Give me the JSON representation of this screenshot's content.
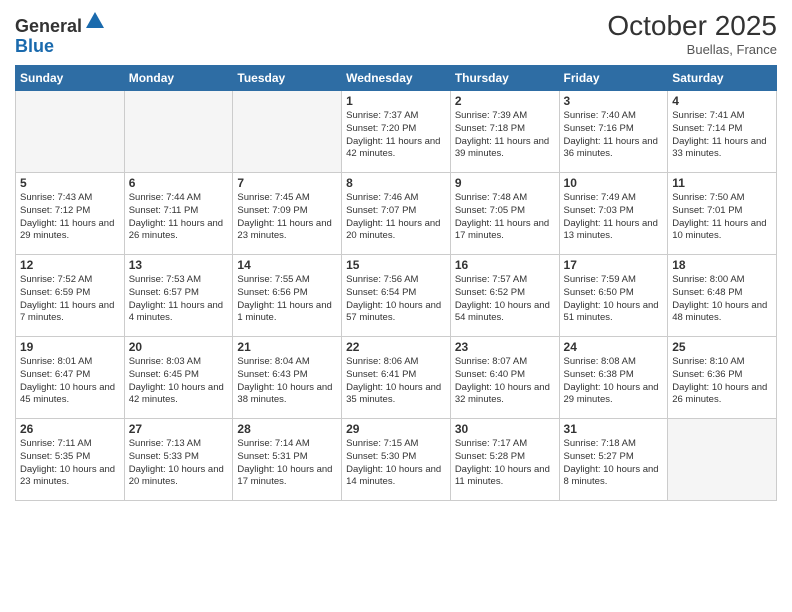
{
  "header": {
    "logo_general": "General",
    "logo_blue": "Blue",
    "month_title": "October 2025",
    "location": "Buellas, France"
  },
  "weekdays": [
    "Sunday",
    "Monday",
    "Tuesday",
    "Wednesday",
    "Thursday",
    "Friday",
    "Saturday"
  ],
  "weeks": [
    [
      {
        "day": "",
        "sunrise": "",
        "sunset": "",
        "daylight": ""
      },
      {
        "day": "",
        "sunrise": "",
        "sunset": "",
        "daylight": ""
      },
      {
        "day": "",
        "sunrise": "",
        "sunset": "",
        "daylight": ""
      },
      {
        "day": "1",
        "sunrise": "Sunrise: 7:37 AM",
        "sunset": "Sunset: 7:20 PM",
        "daylight": "Daylight: 11 hours and 42 minutes."
      },
      {
        "day": "2",
        "sunrise": "Sunrise: 7:39 AM",
        "sunset": "Sunset: 7:18 PM",
        "daylight": "Daylight: 11 hours and 39 minutes."
      },
      {
        "day": "3",
        "sunrise": "Sunrise: 7:40 AM",
        "sunset": "Sunset: 7:16 PM",
        "daylight": "Daylight: 11 hours and 36 minutes."
      },
      {
        "day": "4",
        "sunrise": "Sunrise: 7:41 AM",
        "sunset": "Sunset: 7:14 PM",
        "daylight": "Daylight: 11 hours and 33 minutes."
      }
    ],
    [
      {
        "day": "5",
        "sunrise": "Sunrise: 7:43 AM",
        "sunset": "Sunset: 7:12 PM",
        "daylight": "Daylight: 11 hours and 29 minutes."
      },
      {
        "day": "6",
        "sunrise": "Sunrise: 7:44 AM",
        "sunset": "Sunset: 7:11 PM",
        "daylight": "Daylight: 11 hours and 26 minutes."
      },
      {
        "day": "7",
        "sunrise": "Sunrise: 7:45 AM",
        "sunset": "Sunset: 7:09 PM",
        "daylight": "Daylight: 11 hours and 23 minutes."
      },
      {
        "day": "8",
        "sunrise": "Sunrise: 7:46 AM",
        "sunset": "Sunset: 7:07 PM",
        "daylight": "Daylight: 11 hours and 20 minutes."
      },
      {
        "day": "9",
        "sunrise": "Sunrise: 7:48 AM",
        "sunset": "Sunset: 7:05 PM",
        "daylight": "Daylight: 11 hours and 17 minutes."
      },
      {
        "day": "10",
        "sunrise": "Sunrise: 7:49 AM",
        "sunset": "Sunset: 7:03 PM",
        "daylight": "Daylight: 11 hours and 13 minutes."
      },
      {
        "day": "11",
        "sunrise": "Sunrise: 7:50 AM",
        "sunset": "Sunset: 7:01 PM",
        "daylight": "Daylight: 11 hours and 10 minutes."
      }
    ],
    [
      {
        "day": "12",
        "sunrise": "Sunrise: 7:52 AM",
        "sunset": "Sunset: 6:59 PM",
        "daylight": "Daylight: 11 hours and 7 minutes."
      },
      {
        "day": "13",
        "sunrise": "Sunrise: 7:53 AM",
        "sunset": "Sunset: 6:57 PM",
        "daylight": "Daylight: 11 hours and 4 minutes."
      },
      {
        "day": "14",
        "sunrise": "Sunrise: 7:55 AM",
        "sunset": "Sunset: 6:56 PM",
        "daylight": "Daylight: 11 hours and 1 minute."
      },
      {
        "day": "15",
        "sunrise": "Sunrise: 7:56 AM",
        "sunset": "Sunset: 6:54 PM",
        "daylight": "Daylight: 10 hours and 57 minutes."
      },
      {
        "day": "16",
        "sunrise": "Sunrise: 7:57 AM",
        "sunset": "Sunset: 6:52 PM",
        "daylight": "Daylight: 10 hours and 54 minutes."
      },
      {
        "day": "17",
        "sunrise": "Sunrise: 7:59 AM",
        "sunset": "Sunset: 6:50 PM",
        "daylight": "Daylight: 10 hours and 51 minutes."
      },
      {
        "day": "18",
        "sunrise": "Sunrise: 8:00 AM",
        "sunset": "Sunset: 6:48 PM",
        "daylight": "Daylight: 10 hours and 48 minutes."
      }
    ],
    [
      {
        "day": "19",
        "sunrise": "Sunrise: 8:01 AM",
        "sunset": "Sunset: 6:47 PM",
        "daylight": "Daylight: 10 hours and 45 minutes."
      },
      {
        "day": "20",
        "sunrise": "Sunrise: 8:03 AM",
        "sunset": "Sunset: 6:45 PM",
        "daylight": "Daylight: 10 hours and 42 minutes."
      },
      {
        "day": "21",
        "sunrise": "Sunrise: 8:04 AM",
        "sunset": "Sunset: 6:43 PM",
        "daylight": "Daylight: 10 hours and 38 minutes."
      },
      {
        "day": "22",
        "sunrise": "Sunrise: 8:06 AM",
        "sunset": "Sunset: 6:41 PM",
        "daylight": "Daylight: 10 hours and 35 minutes."
      },
      {
        "day": "23",
        "sunrise": "Sunrise: 8:07 AM",
        "sunset": "Sunset: 6:40 PM",
        "daylight": "Daylight: 10 hours and 32 minutes."
      },
      {
        "day": "24",
        "sunrise": "Sunrise: 8:08 AM",
        "sunset": "Sunset: 6:38 PM",
        "daylight": "Daylight: 10 hours and 29 minutes."
      },
      {
        "day": "25",
        "sunrise": "Sunrise: 8:10 AM",
        "sunset": "Sunset: 6:36 PM",
        "daylight": "Daylight: 10 hours and 26 minutes."
      }
    ],
    [
      {
        "day": "26",
        "sunrise": "Sunrise: 7:11 AM",
        "sunset": "Sunset: 5:35 PM",
        "daylight": "Daylight: 10 hours and 23 minutes."
      },
      {
        "day": "27",
        "sunrise": "Sunrise: 7:13 AM",
        "sunset": "Sunset: 5:33 PM",
        "daylight": "Daylight: 10 hours and 20 minutes."
      },
      {
        "day": "28",
        "sunrise": "Sunrise: 7:14 AM",
        "sunset": "Sunset: 5:31 PM",
        "daylight": "Daylight: 10 hours and 17 minutes."
      },
      {
        "day": "29",
        "sunrise": "Sunrise: 7:15 AM",
        "sunset": "Sunset: 5:30 PM",
        "daylight": "Daylight: 10 hours and 14 minutes."
      },
      {
        "day": "30",
        "sunrise": "Sunrise: 7:17 AM",
        "sunset": "Sunset: 5:28 PM",
        "daylight": "Daylight: 10 hours and 11 minutes."
      },
      {
        "day": "31",
        "sunrise": "Sunrise: 7:18 AM",
        "sunset": "Sunset: 5:27 PM",
        "daylight": "Daylight: 10 hours and 8 minutes."
      },
      {
        "day": "",
        "sunrise": "",
        "sunset": "",
        "daylight": ""
      }
    ]
  ]
}
